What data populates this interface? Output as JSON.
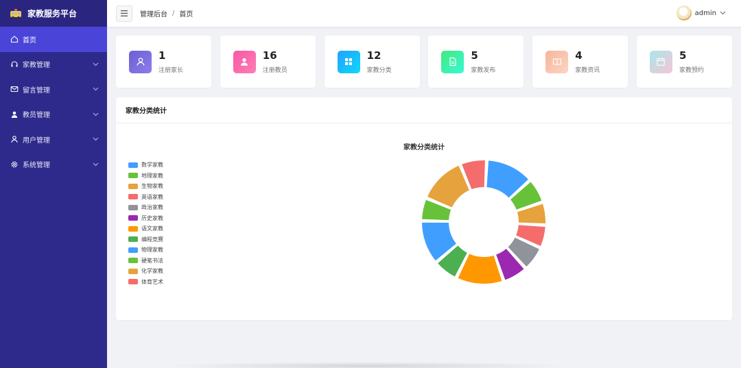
{
  "app": {
    "title": "家教服务平台"
  },
  "sidebar": {
    "items": [
      {
        "label": "首页",
        "icon": "home-icon",
        "active": true,
        "chevron": false
      },
      {
        "label": "家教管理",
        "icon": "headset-icon",
        "active": false,
        "chevron": true
      },
      {
        "label": "留言管理",
        "icon": "mail-icon",
        "active": false,
        "chevron": true
      },
      {
        "label": "教员管理",
        "icon": "person-filled-icon",
        "active": false,
        "chevron": true
      },
      {
        "label": "用户管理",
        "icon": "person-outline-icon",
        "active": false,
        "chevron": true
      },
      {
        "label": "系统管理",
        "icon": "gear-icon",
        "active": false,
        "chevron": true
      }
    ]
  },
  "header": {
    "breadcrumb": [
      "管理后台",
      "首页"
    ],
    "breadcrumb_sep": "/",
    "user": "admin"
  },
  "cards": [
    {
      "value": "1",
      "label": "注册家长",
      "icon": "user-icon",
      "gradient": [
        "#6a5fd6",
        "#8f7de8"
      ]
    },
    {
      "value": "16",
      "label": "注册教员",
      "icon": "user-filled-icon",
      "gradient": [
        "#f857a6",
        "#ff7eb3"
      ]
    },
    {
      "value": "12",
      "label": "家教分类",
      "icon": "grid-icon",
      "gradient": [
        "#1fa2ff",
        "#12d8fa"
      ]
    },
    {
      "value": "5",
      "label": "家教发布",
      "icon": "document-icon",
      "gradient": [
        "#43e97b",
        "#38f9d7"
      ]
    },
    {
      "value": "4",
      "label": "家教资讯",
      "icon": "book-icon",
      "gradient": [
        "#f6b59a",
        "#fcd5c4"
      ]
    },
    {
      "value": "5",
      "label": "家教预约",
      "icon": "calendar-icon",
      "gradient": [
        "#a8e6e8",
        "#f6c6d8"
      ]
    }
  ],
  "panel": {
    "title": "家教分类统计"
  },
  "chart_data": {
    "type": "pie",
    "variant": "donut",
    "title": "家教分类统计",
    "legend_position": "left",
    "categories": [
      "数学家教",
      "地理家教",
      "生物家教",
      "英语家教",
      "政治家教",
      "历史家教",
      "语文家教",
      "编程竞赛",
      "物理家教",
      "硬笔书法",
      "化学家教",
      "体育艺术"
    ],
    "values": [
      2.5,
      1.3,
      1.2,
      1.2,
      1.3,
      1.3,
      2.5,
      1.3,
      2.3,
      1.2,
      2.5,
      1.4
    ],
    "colors": [
      "#409eff",
      "#67c23a",
      "#e6a23c",
      "#f56c6c",
      "#909399",
      "#9c27b0",
      "#ff9800",
      "#4caf50",
      "#409eff",
      "#67c23a",
      "#e6a23c",
      "#f56c6c"
    ]
  }
}
